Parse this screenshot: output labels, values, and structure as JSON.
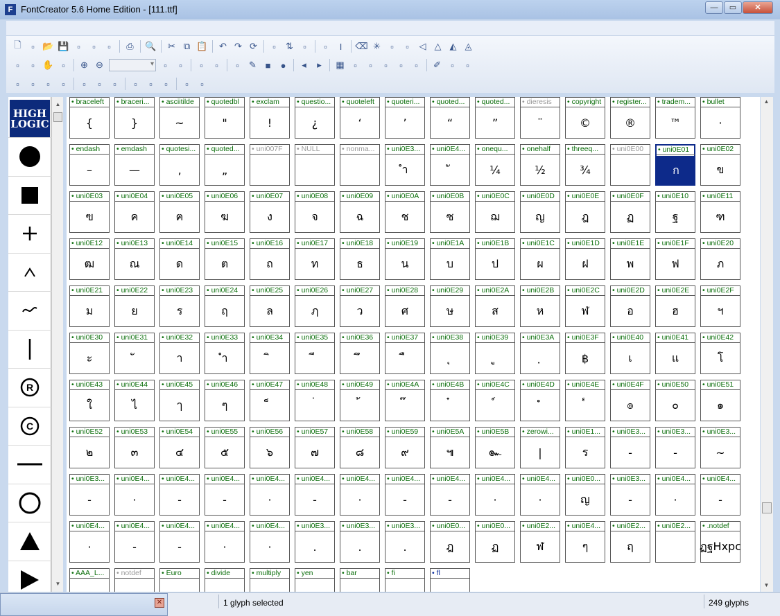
{
  "window": {
    "title": "FontCreator 5.6 Home Edition - [111.ttf]",
    "app_icon": "F"
  },
  "logo": {
    "line1": "HIGH",
    "line2": "LOGIC"
  },
  "shapes": [
    "circle-filled",
    "square-filled",
    "plus",
    "caret",
    "tilde",
    "vertical-bar",
    "registered",
    "copyright",
    "dash",
    "circle-outline",
    "triangle-up",
    "triangle-right"
  ],
  "toolbar": {
    "row1": [
      "new-icon",
      "open-project-icon",
      "open-icon",
      "save-icon",
      "save-as-icon",
      "copy-doc-icon",
      "folder-icon",
      "|",
      "print-icon",
      "|",
      "find-icon",
      "|",
      "cut-icon",
      "copy-icon",
      "paste-icon",
      "|",
      "undo-icon",
      "redo-icon",
      "refresh-icon",
      "|",
      "add-glyph-icon",
      "sort-icon",
      "wizard-icon",
      "|",
      "properties-icon",
      "text-insert-icon",
      "|",
      "eraser-icon",
      "snowflake-icon",
      "fill-icon",
      "spin-icon",
      "arrow-icon",
      "flip-icon",
      "skew-icon",
      "rotate-icon"
    ],
    "row2": [
      "select-rect-icon",
      "lasso-icon",
      "hand-icon",
      "measure-icon",
      "|",
      "zoom-in-icon",
      "zoom-out-icon",
      "combo",
      "frame-icon",
      "metrics-icon",
      "|",
      "pointer-icon",
      "node-icon",
      "|",
      "image-icon",
      "pen-icon",
      "rect-icon",
      "ellipse-icon",
      "|",
      "prev-icon",
      "next-icon",
      "|",
      "grid-icon",
      "grid2-icon",
      "grid3-icon",
      "grid4-icon",
      "grid5-icon",
      "grid6-icon",
      "|",
      "edit-icon",
      "tree-icon",
      "hcm-icon"
    ],
    "row3": [
      "align1-icon",
      "align2-icon",
      "align3-icon",
      "align4-icon",
      "|",
      "align5-icon",
      "align6-icon",
      "align7-icon",
      "|",
      "align8-icon",
      "align9-icon",
      "align10-icon",
      "|",
      "kern-icon",
      "anchor-icon"
    ],
    "combo_value": ""
  },
  "glyphs": [
    {
      "name": "braceleft",
      "ch": "{"
    },
    {
      "name": "braceri...",
      "ch": "}"
    },
    {
      "name": "asciitilde",
      "ch": "~"
    },
    {
      "name": "quotedbl",
      "ch": "\""
    },
    {
      "name": "exclam",
      "ch": "!"
    },
    {
      "name": "questio...",
      "ch": "¿"
    },
    {
      "name": "quoteleft",
      "ch": "‘"
    },
    {
      "name": "quoteri...",
      "ch": "’"
    },
    {
      "name": "quoted...",
      "ch": "“"
    },
    {
      "name": "quoted...",
      "ch": "”"
    },
    {
      "name": "dieresis",
      "ch": "¨",
      "gray": true
    },
    {
      "name": "copyright",
      "ch": "©"
    },
    {
      "name": "register...",
      "ch": "®"
    },
    {
      "name": "tradem...",
      "ch": "™"
    },
    {
      "name": "bullet",
      "ch": "·"
    },
    {
      "name": "endash",
      "ch": "–"
    },
    {
      "name": "emdash",
      "ch": "—"
    },
    {
      "name": "quotesi...",
      "ch": "‚"
    },
    {
      "name": "quoted...",
      "ch": "„"
    },
    {
      "name": "uni007F",
      "ch": "",
      "gray": true
    },
    {
      "name": "NULL",
      "ch": "",
      "gray": true
    },
    {
      "name": "nonma...",
      "ch": "",
      "gray": true
    },
    {
      "name": "uni0E3...",
      "ch": "ำ"
    },
    {
      "name": "uni0E4...",
      "ch": "ั"
    },
    {
      "name": "onequ...",
      "ch": "¼"
    },
    {
      "name": "onehalf",
      "ch": "½"
    },
    {
      "name": "threeq...",
      "ch": "¾"
    },
    {
      "name": "uni0E00",
      "ch": "",
      "gray": true
    },
    {
      "name": "uni0E01",
      "ch": "ก",
      "selected": true
    },
    {
      "name": "uni0E02",
      "ch": "ข"
    },
    {
      "name": "uni0E03",
      "ch": "ฃ"
    },
    {
      "name": "uni0E04",
      "ch": "ค"
    },
    {
      "name": "uni0E05",
      "ch": "ฅ"
    },
    {
      "name": "uni0E06",
      "ch": "ฆ"
    },
    {
      "name": "uni0E07",
      "ch": "ง"
    },
    {
      "name": "uni0E08",
      "ch": "จ"
    },
    {
      "name": "uni0E09",
      "ch": "ฉ"
    },
    {
      "name": "uni0E0A",
      "ch": "ช"
    },
    {
      "name": "uni0E0B",
      "ch": "ซ"
    },
    {
      "name": "uni0E0C",
      "ch": "ฌ"
    },
    {
      "name": "uni0E0D",
      "ch": "ญ"
    },
    {
      "name": "uni0E0E",
      "ch": "ฎ"
    },
    {
      "name": "uni0E0F",
      "ch": "ฏ"
    },
    {
      "name": "uni0E10",
      "ch": "ฐ"
    },
    {
      "name": "uni0E11",
      "ch": "ฑ"
    },
    {
      "name": "uni0E12",
      "ch": "ฒ"
    },
    {
      "name": "uni0E13",
      "ch": "ณ"
    },
    {
      "name": "uni0E14",
      "ch": "ด"
    },
    {
      "name": "uni0E15",
      "ch": "ต"
    },
    {
      "name": "uni0E16",
      "ch": "ถ"
    },
    {
      "name": "uni0E17",
      "ch": "ท"
    },
    {
      "name": "uni0E18",
      "ch": "ธ"
    },
    {
      "name": "uni0E19",
      "ch": "น"
    },
    {
      "name": "uni0E1A",
      "ch": "บ"
    },
    {
      "name": "uni0E1B",
      "ch": "ป"
    },
    {
      "name": "uni0E1C",
      "ch": "ผ"
    },
    {
      "name": "uni0E1D",
      "ch": "ฝ"
    },
    {
      "name": "uni0E1E",
      "ch": "พ"
    },
    {
      "name": "uni0E1F",
      "ch": "ฟ"
    },
    {
      "name": "uni0E20",
      "ch": "ภ"
    },
    {
      "name": "uni0E21",
      "ch": "ม"
    },
    {
      "name": "uni0E22",
      "ch": "ย"
    },
    {
      "name": "uni0E23",
      "ch": "ร"
    },
    {
      "name": "uni0E24",
      "ch": "ฤ"
    },
    {
      "name": "uni0E25",
      "ch": "ล"
    },
    {
      "name": "uni0E26",
      "ch": "ฦ"
    },
    {
      "name": "uni0E27",
      "ch": "ว"
    },
    {
      "name": "uni0E28",
      "ch": "ศ"
    },
    {
      "name": "uni0E29",
      "ch": "ษ"
    },
    {
      "name": "uni0E2A",
      "ch": "ส"
    },
    {
      "name": "uni0E2B",
      "ch": "ห"
    },
    {
      "name": "uni0E2C",
      "ch": "ฬ"
    },
    {
      "name": "uni0E2D",
      "ch": "อ"
    },
    {
      "name": "uni0E2E",
      "ch": "ฮ"
    },
    {
      "name": "uni0E2F",
      "ch": "ฯ"
    },
    {
      "name": "uni0E30",
      "ch": "ะ"
    },
    {
      "name": "uni0E31",
      "ch": "ั"
    },
    {
      "name": "uni0E32",
      "ch": "า"
    },
    {
      "name": "uni0E33",
      "ch": "ำ"
    },
    {
      "name": "uni0E34",
      "ch": "ิ"
    },
    {
      "name": "uni0E35",
      "ch": "ี"
    },
    {
      "name": "uni0E36",
      "ch": "ึ"
    },
    {
      "name": "uni0E37",
      "ch": "ื"
    },
    {
      "name": "uni0E38",
      "ch": "ุ"
    },
    {
      "name": "uni0E39",
      "ch": "ู"
    },
    {
      "name": "uni0E3A",
      "ch": "ฺ"
    },
    {
      "name": "uni0E3F",
      "ch": "฿"
    },
    {
      "name": "uni0E40",
      "ch": "เ"
    },
    {
      "name": "uni0E41",
      "ch": "แ"
    },
    {
      "name": "uni0E42",
      "ch": "โ"
    },
    {
      "name": "uni0E43",
      "ch": "ใ"
    },
    {
      "name": "uni0E44",
      "ch": "ไ"
    },
    {
      "name": "uni0E45",
      "ch": "ๅ"
    },
    {
      "name": "uni0E46",
      "ch": "ๆ"
    },
    {
      "name": "uni0E47",
      "ch": "็"
    },
    {
      "name": "uni0E48",
      "ch": "่"
    },
    {
      "name": "uni0E49",
      "ch": "้"
    },
    {
      "name": "uni0E4A",
      "ch": "๊"
    },
    {
      "name": "uni0E4B",
      "ch": "๋"
    },
    {
      "name": "uni0E4C",
      "ch": "์"
    },
    {
      "name": "uni0E4D",
      "ch": "ํ"
    },
    {
      "name": "uni0E4E",
      "ch": "๎"
    },
    {
      "name": "uni0E4F",
      "ch": "๏"
    },
    {
      "name": "uni0E50",
      "ch": "๐"
    },
    {
      "name": "uni0E51",
      "ch": "๑"
    },
    {
      "name": "uni0E52",
      "ch": "๒"
    },
    {
      "name": "uni0E53",
      "ch": "๓"
    },
    {
      "name": "uni0E54",
      "ch": "๔"
    },
    {
      "name": "uni0E55",
      "ch": "๕"
    },
    {
      "name": "uni0E56",
      "ch": "๖"
    },
    {
      "name": "uni0E57",
      "ch": "๗"
    },
    {
      "name": "uni0E58",
      "ch": "๘"
    },
    {
      "name": "uni0E59",
      "ch": "๙"
    },
    {
      "name": "uni0E5A",
      "ch": "๚"
    },
    {
      "name": "uni0E5B",
      "ch": "๛"
    },
    {
      "name": "zerowi...",
      "ch": "|"
    },
    {
      "name": "uni0E1...",
      "ch": "ร"
    },
    {
      "name": "uni0E3...",
      "ch": "-"
    },
    {
      "name": "uni0E3...",
      "ch": "-"
    },
    {
      "name": "uni0E3...",
      "ch": "~"
    },
    {
      "name": "uni0E3...",
      "ch": "-"
    },
    {
      "name": "uni0E4...",
      "ch": "·"
    },
    {
      "name": "uni0E4...",
      "ch": "-"
    },
    {
      "name": "uni0E4...",
      "ch": "-"
    },
    {
      "name": "uni0E4...",
      "ch": "·"
    },
    {
      "name": "uni0E4...",
      "ch": "-"
    },
    {
      "name": "uni0E4...",
      "ch": "·"
    },
    {
      "name": "uni0E4...",
      "ch": "-"
    },
    {
      "name": "uni0E4...",
      "ch": "-"
    },
    {
      "name": "uni0E4...",
      "ch": "·"
    },
    {
      "name": "uni0E4...",
      "ch": "·"
    },
    {
      "name": "uni0E0...",
      "ch": "ญ"
    },
    {
      "name": "uni0E3...",
      "ch": "-"
    },
    {
      "name": "uni0E4...",
      "ch": "·"
    },
    {
      "name": "uni0E4...",
      "ch": "-"
    },
    {
      "name": "uni0E4...",
      "ch": "·"
    },
    {
      "name": "uni0E4...",
      "ch": "-"
    },
    {
      "name": "uni0E4...",
      "ch": "-"
    },
    {
      "name": "uni0E4...",
      "ch": "·"
    },
    {
      "name": "uni0E4...",
      "ch": "·"
    },
    {
      "name": "uni0E3...",
      "ch": "."
    },
    {
      "name": "uni0E3...",
      "ch": "."
    },
    {
      "name": "uni0E3...",
      "ch": "."
    },
    {
      "name": "uni0E0...",
      "ch": "ฎ"
    },
    {
      "name": "uni0E0...",
      "ch": "ฏ"
    },
    {
      "name": "uni0E2...",
      "ch": "ฬ"
    },
    {
      "name": "uni0E4...",
      "ch": "ๆ"
    },
    {
      "name": "uni0E2...",
      "ch": "ฤ"
    },
    {
      "name": "uni0E2...",
      "ch": ""
    },
    {
      "name": ".notdef",
      "ch": "ฏฐHxpc"
    },
    {
      "name": "AAA_L...",
      "ch": ""
    },
    {
      "name": "notdef",
      "ch": "",
      "gray": true
    },
    {
      "name": "Euro",
      "ch": ""
    },
    {
      "name": "divide",
      "ch": ""
    },
    {
      "name": "multiply",
      "ch": ""
    },
    {
      "name": "yen",
      "ch": ""
    },
    {
      "name": "bar",
      "ch": ""
    },
    {
      "name": "fi",
      "ch": ""
    },
    {
      "name": "fl",
      "ch": "",
      "blue": true
    }
  ],
  "status": {
    "selected": "1 glyph selected",
    "count": "249 glyphs"
  }
}
